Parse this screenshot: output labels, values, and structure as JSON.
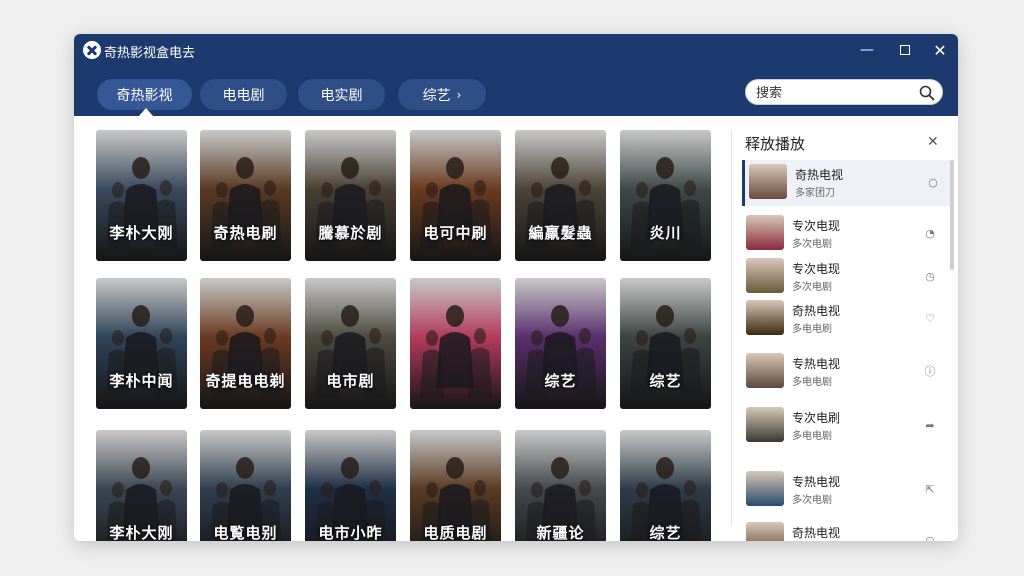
{
  "app": {
    "title": "奇热影视盒电去"
  },
  "window_controls": {
    "minimize": "—",
    "close": "✕"
  },
  "tabs": [
    {
      "label": "奇热影视",
      "active": true
    },
    {
      "label": "电电剧",
      "active": false
    },
    {
      "label": "电实剧",
      "active": false
    },
    {
      "label": "综艺",
      "active": false,
      "arrow": "›"
    }
  ],
  "search": {
    "placeholder": "搜索"
  },
  "posters": [
    {
      "caption": "李朴大刚",
      "bg": "#3a4a5e"
    },
    {
      "caption": "奇热电刷",
      "bg": "#5a3a22"
    },
    {
      "caption": "騰慕於剧",
      "bg": "#4a4034"
    },
    {
      "caption": "电可中刷",
      "bg": "#6a3a1e"
    },
    {
      "caption": "編羸髮蟲",
      "bg": "#4d4438"
    },
    {
      "caption": "炎川",
      "bg": "#3e4a48"
    },
    {
      "caption": "李朴中闻",
      "bg": "#2f4458"
    },
    {
      "caption": "奇提电电剃",
      "bg": "#6a3a20"
    },
    {
      "caption": "电市剧",
      "bg": "#4e4a40"
    },
    {
      "caption": "",
      "bg": "#b33b5c"
    },
    {
      "caption": "综艺",
      "bg": "#5a2f6e"
    },
    {
      "caption": "综艺",
      "bg": "#3c4442"
    },
    {
      "caption": "李朴大刚",
      "bg": "#3a4654"
    },
    {
      "caption": "电覧电别",
      "bg": "#2e3e4e"
    },
    {
      "caption": "电市小昨",
      "bg": "#1f2f45"
    },
    {
      "caption": "电质电剧",
      "bg": "#5a3a22"
    },
    {
      "caption": "新疆论",
      "bg": "#44484c"
    },
    {
      "caption": "综艺",
      "bg": "#2e3c48"
    }
  ],
  "panel": {
    "title": "释放播放",
    "close": "✕",
    "items": [
      {
        "name": "奇热电视",
        "sub": "多家团刀",
        "icon": "circle-icon",
        "glyph": "○",
        "thumb": "#6a4a3a",
        "selected": true
      },
      {
        "name": "专次电现",
        "sub": "多次电剧",
        "icon": "clock-icon",
        "glyph": "◔",
        "thumb": "#8a2a3e",
        "selected": false
      },
      {
        "name": "专次电现",
        "sub": "多次电剧",
        "icon": "timer-icon",
        "glyph": "◷",
        "thumb": "#6a5a3a",
        "selected": false
      },
      {
        "name": "奇热电视",
        "sub": "多电电刷",
        "icon": "heart-icon",
        "glyph": "♡",
        "thumb": "#3a2a10",
        "selected": false
      },
      {
        "name": "专热电视",
        "sub": "多电电剧",
        "icon": "info-icon",
        "glyph": "ⓘ",
        "thumb": "#5a4a3e",
        "selected": false
      },
      {
        "name": "专次电刷",
        "sub": "多电电剧",
        "icon": "share-icon",
        "glyph": "➦",
        "thumb": "#3a3a30",
        "selected": false
      },
      {
        "name": "专热电视",
        "sub": "多次电剧",
        "icon": "export-icon",
        "glyph": "⇱",
        "thumb": "#2a4a6e",
        "selected": false
      },
      {
        "name": "奇热电视",
        "sub": "",
        "icon": "circle-icon",
        "glyph": "○",
        "thumb": "#5a3a2a",
        "selected": false
      }
    ]
  }
}
